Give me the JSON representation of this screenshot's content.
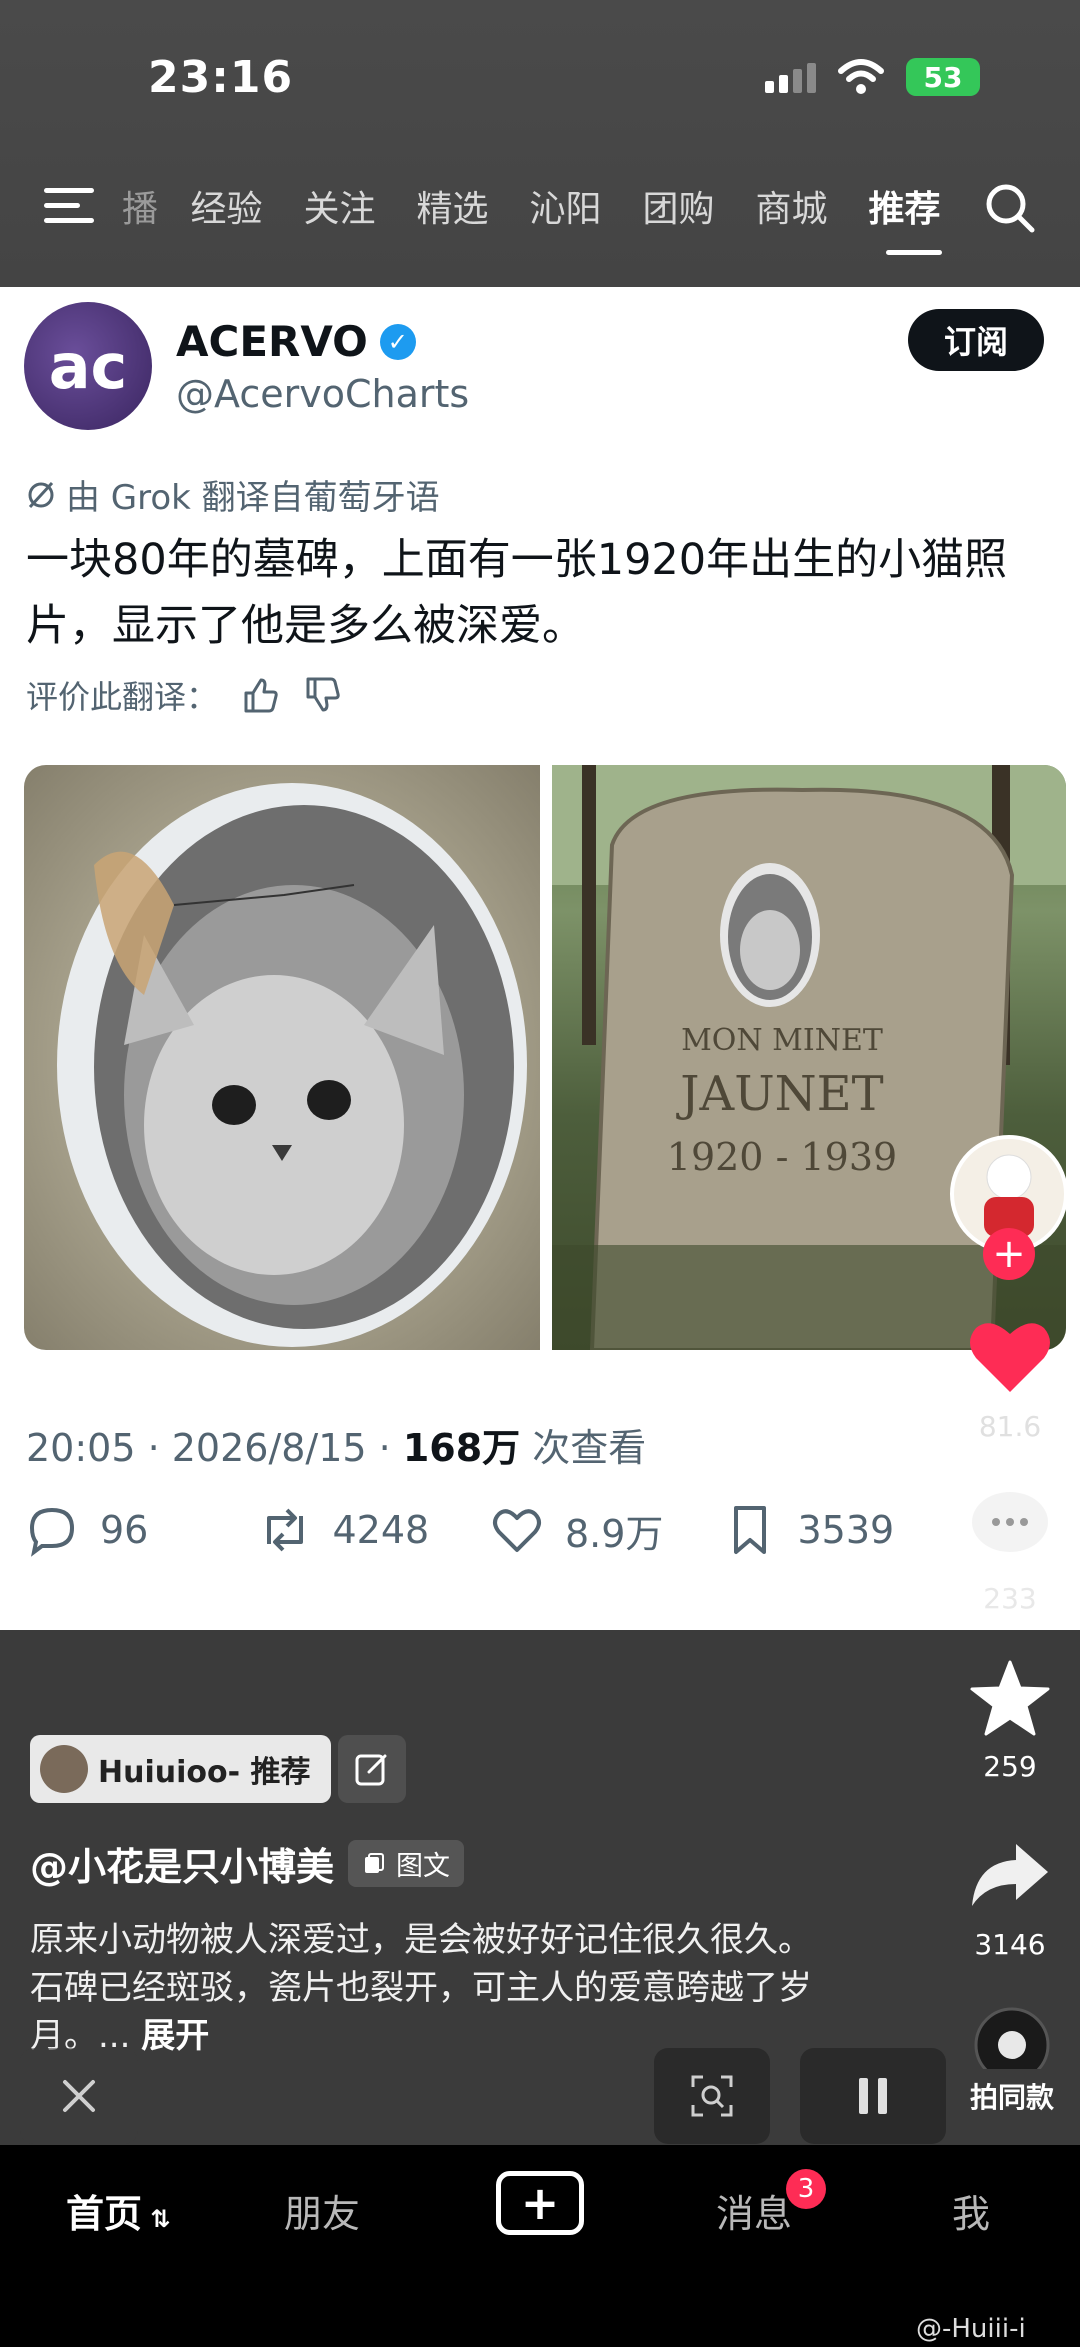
{
  "status": {
    "time": "23:16",
    "battery": "53"
  },
  "nav": {
    "tabs": [
      "播",
      "经验",
      "关注",
      "精选",
      "沁阳",
      "团购",
      "商城",
      "推荐"
    ],
    "active_index": 7
  },
  "post": {
    "account_initials": "ac",
    "account_name": "ACERVO",
    "handle": "@AcervoCharts",
    "subscribe_label": "订阅",
    "translation_note": "由 Grok 翻译自葡萄牙语",
    "text": "一块80年的墓碑，上面有一张1920年出生的小猫照片，显示了他是多么被深爱。",
    "rate_label": "评价此翻译：",
    "gravestone_text": [
      "MON MINET",
      "JAUNET",
      "1920 - 1939"
    ],
    "meta_time": "20:05 · 2026/8/15 · ",
    "meta_views": "168万",
    "meta_views_suffix": " 次查看",
    "replies": "96",
    "retweets": "4248",
    "likes": "8.9万",
    "bookmarks": "3539"
  },
  "side": {
    "likes": "81.6",
    "comments": "233",
    "favorites": "259",
    "shares": "3146",
    "same_style": "拍同款"
  },
  "feed": {
    "rec_user": "Huiuioo- 推荐",
    "author": "@小花是只小博美",
    "type_tag": "图文",
    "caption_line1": "原来小动物被人深爱过，是会被好好记住很久很久。",
    "caption_line2": "石碑已经斑驳，瓷片也裂开，可主人的爱意跨越了岁月。...",
    "caption_more": "展开"
  },
  "tabbar": {
    "home": "首页",
    "friends": "朋友",
    "messages": "消息",
    "messages_badge": "3",
    "me": "我"
  },
  "watermark": "@-Huiii-i",
  "colors": {
    "accent_red": "#fe2c55",
    "verified_blue": "#1d9bf0",
    "battery_green": "#34c759"
  }
}
